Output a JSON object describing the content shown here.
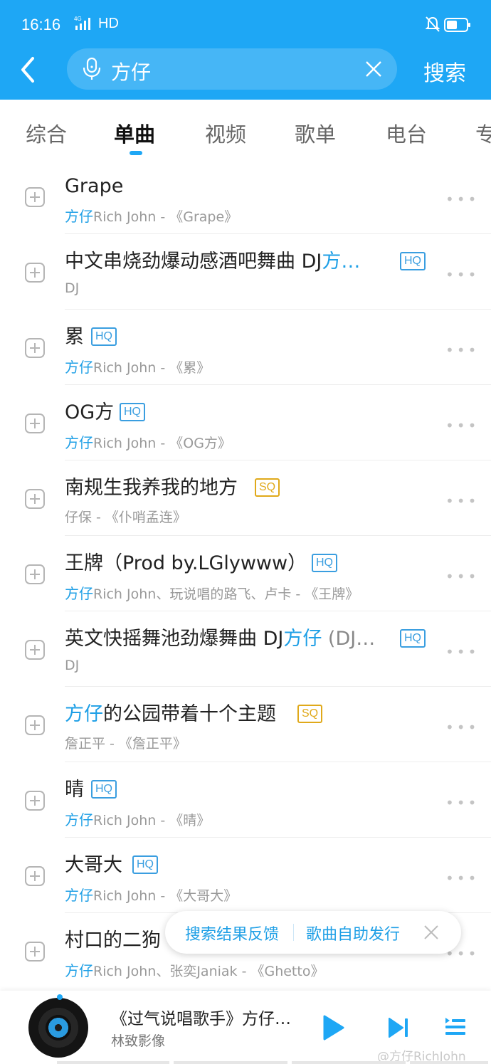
{
  "status_bar": {
    "time": "16:16",
    "network": "4G",
    "hd": "HD"
  },
  "header": {
    "search_query": "方仔",
    "search_button": "搜索"
  },
  "tabs": [
    {
      "label": "综合",
      "active": false
    },
    {
      "label": "单曲",
      "active": true
    },
    {
      "label": "视频",
      "active": false
    },
    {
      "label": "歌单",
      "active": false
    },
    {
      "label": "电台",
      "active": false
    },
    {
      "label": "专",
      "active": false
    }
  ],
  "songs": [
    {
      "title": "Grape",
      "badge": "",
      "sub_highlight": "方仔",
      "sub": "Rich John - 《Grape》"
    },
    {
      "title_pre": "中文串烧劲爆动感酒吧舞曲 DJ",
      "title_hl": "方…",
      "badge": "HQ",
      "sub_highlight": "",
      "sub": "DJ"
    },
    {
      "title": "累",
      "badge": "HQ",
      "sub_highlight": "方仔",
      "sub": "Rich John - 《累》"
    },
    {
      "title": "OG方",
      "badge": "HQ",
      "sub_highlight": "方仔",
      "sub": "Rich John - 《OG方》"
    },
    {
      "title": "南规生我养我的地方",
      "badge": "SQ",
      "sub_highlight": "",
      "sub": "仔保 - 《仆哨孟连》"
    },
    {
      "title": "王牌（Prod by.LGlywww）",
      "badge": "HQ",
      "sub_highlight": "方仔",
      "sub": "Rich John、玩说唱的路飞、卢卡 - 《王牌》"
    },
    {
      "title_pre": "英文快摇舞池劲爆舞曲 DJ",
      "title_hl": "方仔",
      "title_dim": " (DJ…",
      "badge": "HQ",
      "sub_highlight": "",
      "sub": "DJ"
    },
    {
      "title_hl_first": "方仔",
      "title": "的公园带着十个主题",
      "badge": "SQ",
      "sub_highlight": "",
      "sub": "詹正平 - 《詹正平》"
    },
    {
      "title": "晴",
      "badge": "HQ",
      "sub_highlight": "方仔",
      "sub": "Rich John - 《晴》"
    },
    {
      "title": "大哥大",
      "badge": "HQ",
      "sub_highlight": "方仔",
      "sub": "Rich John - 《大哥大》"
    },
    {
      "title": "村口的二狗",
      "badge": "",
      "sub_highlight": "方仔",
      "sub": "Rich John、张奕Janiak - 《Ghetto》"
    }
  ],
  "feedback": {
    "search_feedback": "搜索结果反馈",
    "self_release": "歌曲自助发行"
  },
  "player": {
    "title": "《过气说唱歌手》方仔…",
    "artist": "林致影像"
  },
  "watermark": "@方仔RichJohn",
  "colors": {
    "accent": "#1ea7f5",
    "highlight": "#1e9fe6",
    "hq_badge": "#3a9ee0",
    "sq_badge": "#e0a91a"
  }
}
